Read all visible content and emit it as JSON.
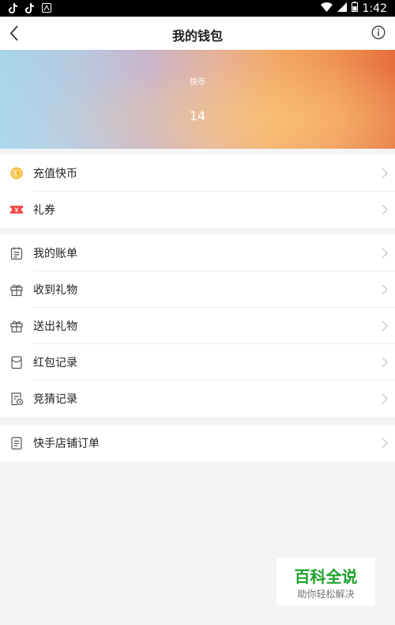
{
  "status_bar": {
    "time": "1:42",
    "left_icons": [
      "tiktok-icon",
      "tiktok-icon",
      "app-icon"
    ],
    "right_icons": [
      "wifi-icon",
      "signal-icon",
      "battery-icon"
    ]
  },
  "header": {
    "title": "我的钱包",
    "back_icon": "chevron-left-icon",
    "info_icon": "info-icon"
  },
  "banner": {
    "coin_label": "快币",
    "coin_value": "14"
  },
  "groups": [
    {
      "items": [
        {
          "label": "充值快币",
          "icon": "coin-icon"
        },
        {
          "label": "礼券",
          "icon": "ticket-icon"
        }
      ]
    },
    {
      "items": [
        {
          "label": "我的账单",
          "icon": "bill-icon"
        },
        {
          "label": "收到礼物",
          "icon": "gift-icon"
        },
        {
          "label": "送出礼物",
          "icon": "gift-icon"
        },
        {
          "label": "红包记录",
          "icon": "red-packet-icon"
        },
        {
          "label": "竞猜记录",
          "icon": "quiz-record-icon"
        }
      ]
    },
    {
      "items": [
        {
          "label": "快手店铺订单",
          "icon": "order-icon"
        }
      ]
    }
  ],
  "watermark": {
    "title": "百科全说",
    "subtitle": "助你轻松解决"
  },
  "colors": {
    "coin_gold": "#f5b623",
    "ticket_red": "#f24f4f",
    "watermark_green": "#1da12a"
  }
}
